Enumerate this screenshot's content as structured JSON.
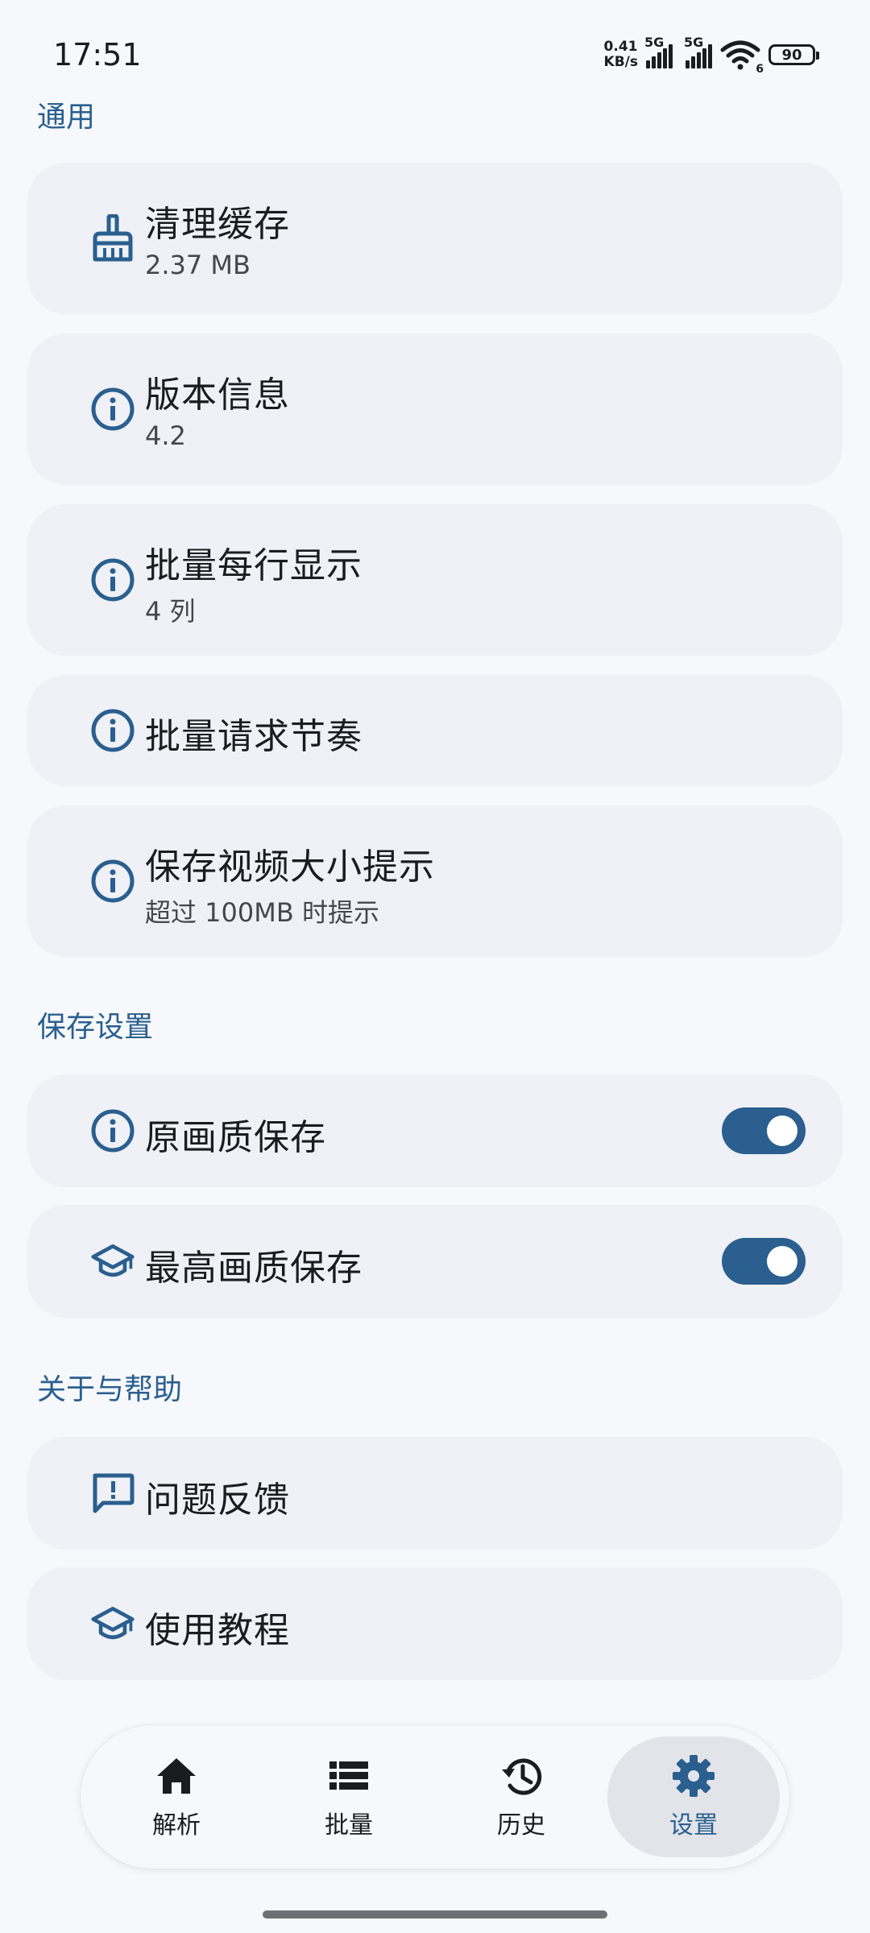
{
  "status_bar": {
    "time": "17:51",
    "net_speed_value": "0.41",
    "net_speed_unit": "KB/s",
    "sim1_gen": "5G",
    "sim2_gen": "5G",
    "wifi_label": "6",
    "battery": "90"
  },
  "sections": {
    "general": "通用",
    "save_settings": "保存设置",
    "about_help": "关于与帮助"
  },
  "items": {
    "clear_cache": {
      "title": "清理缓存",
      "subtitle": "2.37 MB",
      "icon": "broom-icon"
    },
    "version": {
      "title": "版本信息",
      "subtitle": "4.2",
      "icon": "info-icon"
    },
    "batch_columns": {
      "title": "批量每行显示",
      "subtitle": "4 列",
      "icon": "info-icon"
    },
    "batch_rhythm": {
      "title": "批量请求节奏",
      "icon": "info-icon"
    },
    "video_size_hint": {
      "title": "保存视频大小提示",
      "subtitle": "超过 100MB 时提示",
      "icon": "info-icon"
    },
    "original_quality": {
      "title": "原画质保存",
      "icon": "info-icon",
      "enabled": true
    },
    "highest_quality": {
      "title": "最高画质保存",
      "icon": "school-icon",
      "enabled": true
    },
    "feedback": {
      "title": "问题反馈",
      "icon": "feedback-icon"
    },
    "tutorial": {
      "title": "使用教程",
      "icon": "school-icon"
    }
  },
  "bottom_nav": {
    "items": [
      {
        "label": "解析",
        "icon": "home-icon"
      },
      {
        "label": "批量",
        "icon": "list-icon"
      },
      {
        "label": "历史",
        "icon": "history-icon"
      },
      {
        "label": "设置",
        "icon": "gear-icon",
        "active": true
      }
    ]
  },
  "colors": {
    "accent": "#2a5f8f",
    "background": "#f7f8fc",
    "card": "#eff1f6"
  }
}
